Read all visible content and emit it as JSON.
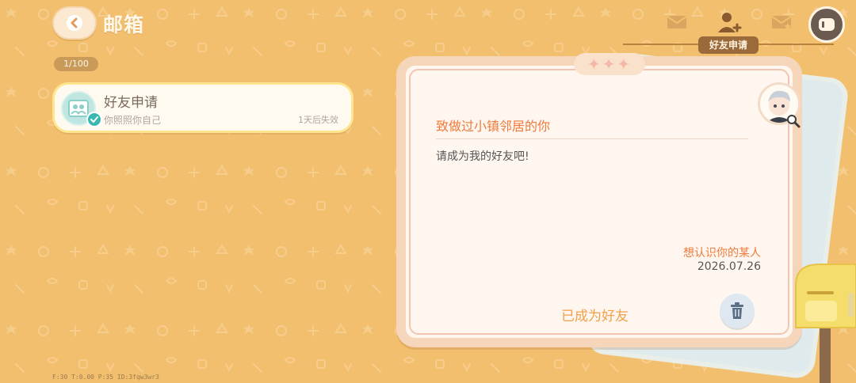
{
  "header": {
    "title": "邮箱"
  },
  "mailbox": {
    "counter": "1/100",
    "items": [
      {
        "title": "好友申请",
        "subtitle": "你照照你自己",
        "expire": "1天后失效"
      }
    ]
  },
  "tabs": {
    "active_label": "好友申请"
  },
  "letter": {
    "subject": "致做过小镇邻居的你",
    "body": "请成为我的好友吧!",
    "sender": "想认识你的某人",
    "date": "2026.07.26",
    "status": "已成为好友",
    "decoration": "✦✦✦"
  },
  "debug": "F:30  T:0.00  P:35  ID:3fqw3wr3",
  "colors": {
    "background": "#f2bf6e",
    "accent_orange": "#f07a3c",
    "selected_border": "#ffe58f",
    "teal_check": "#39b8b0"
  }
}
